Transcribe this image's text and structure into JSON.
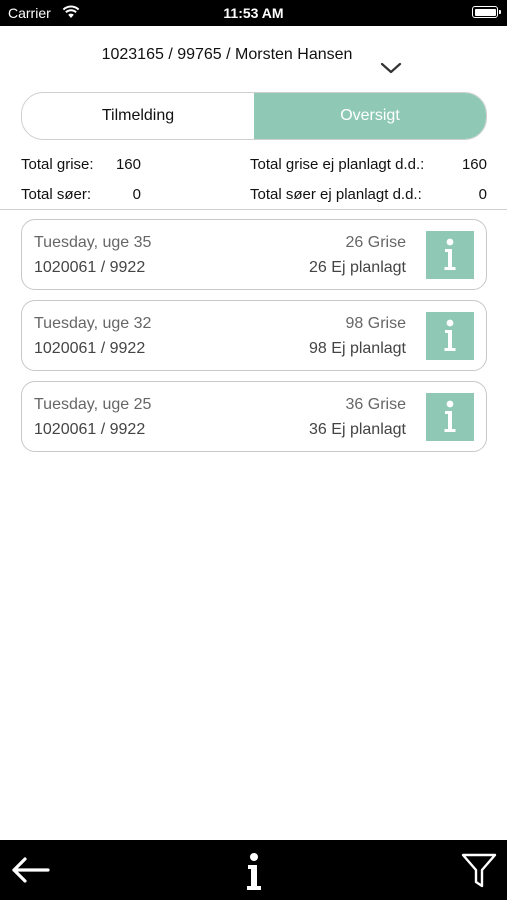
{
  "status_bar": {
    "carrier": "Carrier",
    "time": "11:53 AM"
  },
  "header": {
    "title": "1023165 / 99765 / Morsten Hansen"
  },
  "tabs": [
    {
      "label": "Tilmelding",
      "active": false
    },
    {
      "label": "Oversigt",
      "active": true
    }
  ],
  "totals": {
    "total_grise_label": "Total grise:",
    "total_grise_value": "160",
    "total_soer_label": "Total søer:",
    "total_soer_value": "0",
    "total_grise_unplanned_label": "Total grise ej planlagt d.d.:",
    "total_grise_unplanned_value": "160",
    "total_soer_unplanned_label": "Total søer ej planlagt d.d.:",
    "total_soer_unplanned_value": "0"
  },
  "entries": [
    {
      "date": "Tuesday, uge 35",
      "ids": "1020061 / 9922",
      "count": "26 Grise",
      "planned": "26 Ej planlagt"
    },
    {
      "date": "Tuesday, uge 32",
      "ids": "1020061 / 9922",
      "count": "98 Grise",
      "planned": "98 Ej planlagt"
    },
    {
      "date": "Tuesday, uge 25",
      "ids": "1020061 / 9922",
      "count": "36 Grise",
      "planned": "36 Ej planlagt"
    }
  ],
  "colors": {
    "accent": "#8fc9b6",
    "bar_background": "#000000"
  },
  "icons": {
    "chevron": "chevron-down-icon",
    "card_info": "info-icon",
    "back": "arrow-left-icon",
    "bottom_info": "info-icon",
    "filter": "filter-icon"
  }
}
